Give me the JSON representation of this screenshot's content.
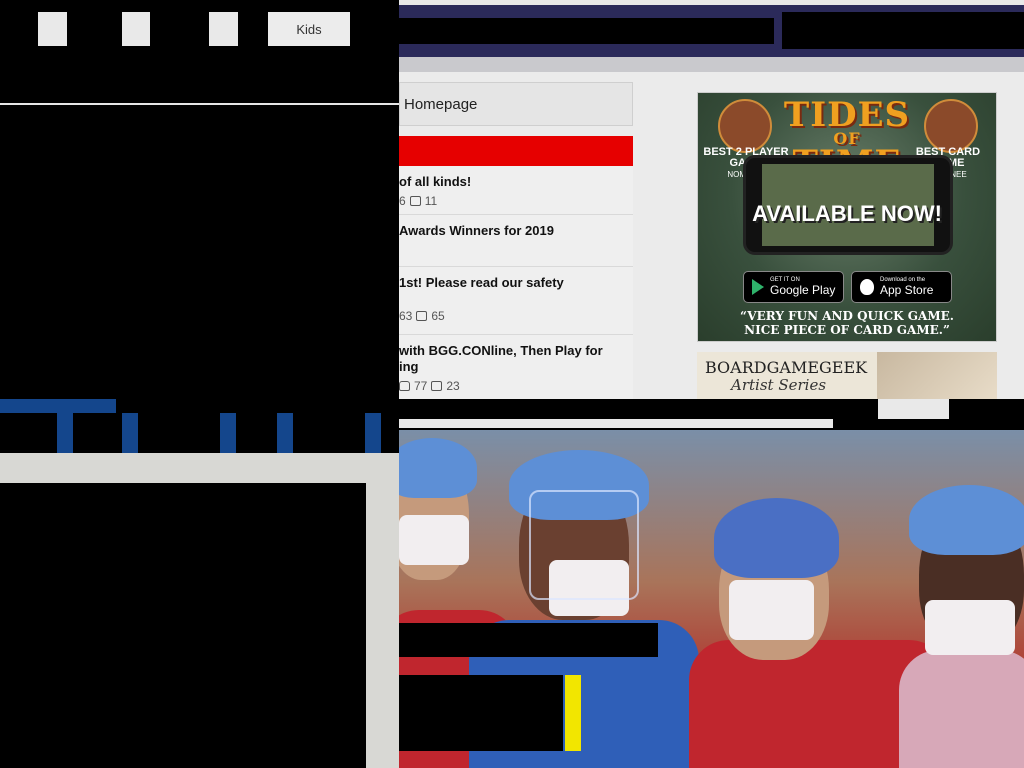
{
  "top_left": {
    "nav_label": "Kids"
  },
  "forum": {
    "homepage_label": "Homepage",
    "items": [
      {
        "title": "of all kinds!",
        "likes": "6",
        "comments": "11"
      },
      {
        "title": "Awards Winners for 2019",
        "likes": "",
        "comments": ""
      },
      {
        "title": "1st! Please read our safety",
        "likes": "63",
        "comments": "65"
      },
      {
        "title": "with BGG.CONline, Then Play for",
        "title_line2": "ing",
        "likes": "77",
        "comments": "23"
      }
    ]
  },
  "ad_tides": {
    "title": "TIDES",
    "title_small": "OF",
    "title_2": "TIME",
    "badge_left_line1": "BEST 2 PLAYER",
    "badge_left_line2": "GAME",
    "badge_left_nominee": "NOMINEE",
    "badge_right_line1": "BEST CARD",
    "badge_right_line2": "GAME",
    "badge_right_nominee": "NOMINEE",
    "available": "AVAILABLE NOW!",
    "google_small": "GET IT ON",
    "google_label": "Google Play",
    "apple_small": "Download on the",
    "apple_label": "App Store",
    "quote_line1": "“VERY FUN AND QUICK GAME.",
    "quote_line2": "NICE PIECE OF CARD GAME.”"
  },
  "ad_artist": {
    "line1": "BOARDGAMEGEEK",
    "line2": "Artist Series"
  },
  "colors": {
    "nav_purple": "#2b2a5a",
    "alert_red": "#e60000",
    "accent_blue": "#14468c",
    "scrub_red": "#c0262e",
    "highlight_yellow": "#f2e600"
  }
}
